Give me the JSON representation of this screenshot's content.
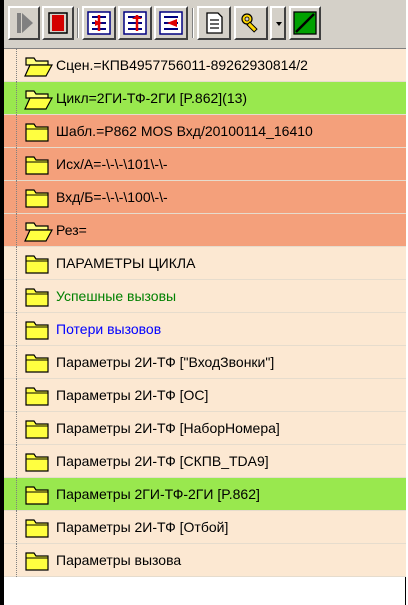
{
  "toolbar": {
    "buttons": [
      {
        "icon": "play-icon"
      },
      {
        "icon": "stop-icon"
      },
      {
        "icon": "step-into-icon"
      },
      {
        "icon": "step-over-icon"
      },
      {
        "icon": "step-out-icon"
      },
      {
        "icon": "document-icon"
      },
      {
        "icon": "tools-icon"
      },
      {
        "icon": "dropdown-arrow-icon"
      },
      {
        "icon": "check-green-icon"
      }
    ]
  },
  "colors": {
    "row_default": "#fce8d2",
    "row_highlight_green": "#99e84e",
    "row_highlight_red": "#f4a07b",
    "text_green": "#008000",
    "text_blue": "#0000ff"
  },
  "tree": {
    "items": [
      {
        "label": "Сцен.=КПВ4957756011-89262930814/2",
        "state": "open",
        "bg": "default",
        "color": "default"
      },
      {
        "label": "Цикл=2ГИ-ТФ-2ГИ [P.862](13)",
        "state": "open",
        "bg": "green",
        "color": "default"
      },
      {
        "label": "Шабл.=P862 MOS Вхд/20100114_16410",
        "state": "closed",
        "bg": "red",
        "color": "default"
      },
      {
        "label": "Исх/А=-\\-\\-\\101\\-\\-",
        "state": "closed",
        "bg": "red",
        "color": "default"
      },
      {
        "label": "Вхд/Б=-\\-\\-\\100\\-\\-",
        "state": "closed",
        "bg": "red",
        "color": "default"
      },
      {
        "label": "Рез=",
        "state": "open",
        "bg": "red",
        "color": "default"
      },
      {
        "label": "ПАРАМЕТРЫ ЦИКЛА",
        "state": "closed",
        "bg": "default",
        "color": "default"
      },
      {
        "label": "Успешные вызовы",
        "state": "closed",
        "bg": "default",
        "color": "green"
      },
      {
        "label": "Потери вызовов",
        "state": "closed",
        "bg": "default",
        "color": "blue"
      },
      {
        "label": "Параметры 2И-ТФ [\"ВходЗвонки\"]",
        "state": "closed",
        "bg": "default",
        "color": "default"
      },
      {
        "label": "Параметры 2И-ТФ [ОС]",
        "state": "closed",
        "bg": "default",
        "color": "default"
      },
      {
        "label": "Параметры 2И-ТФ [НаборНомера]",
        "state": "closed",
        "bg": "default",
        "color": "default"
      },
      {
        "label": "Параметры 2И-ТФ [СКПВ_TDA9]",
        "state": "closed",
        "bg": "default",
        "color": "default"
      },
      {
        "label": "Параметры 2ГИ-ТФ-2ГИ [P.862]",
        "state": "closed",
        "bg": "green",
        "color": "default"
      },
      {
        "label": "Параметры 2И-ТФ [Отбой]",
        "state": "closed",
        "bg": "default",
        "color": "default"
      },
      {
        "label": "Параметры вызова",
        "state": "closed",
        "bg": "default",
        "color": "default"
      }
    ]
  }
}
